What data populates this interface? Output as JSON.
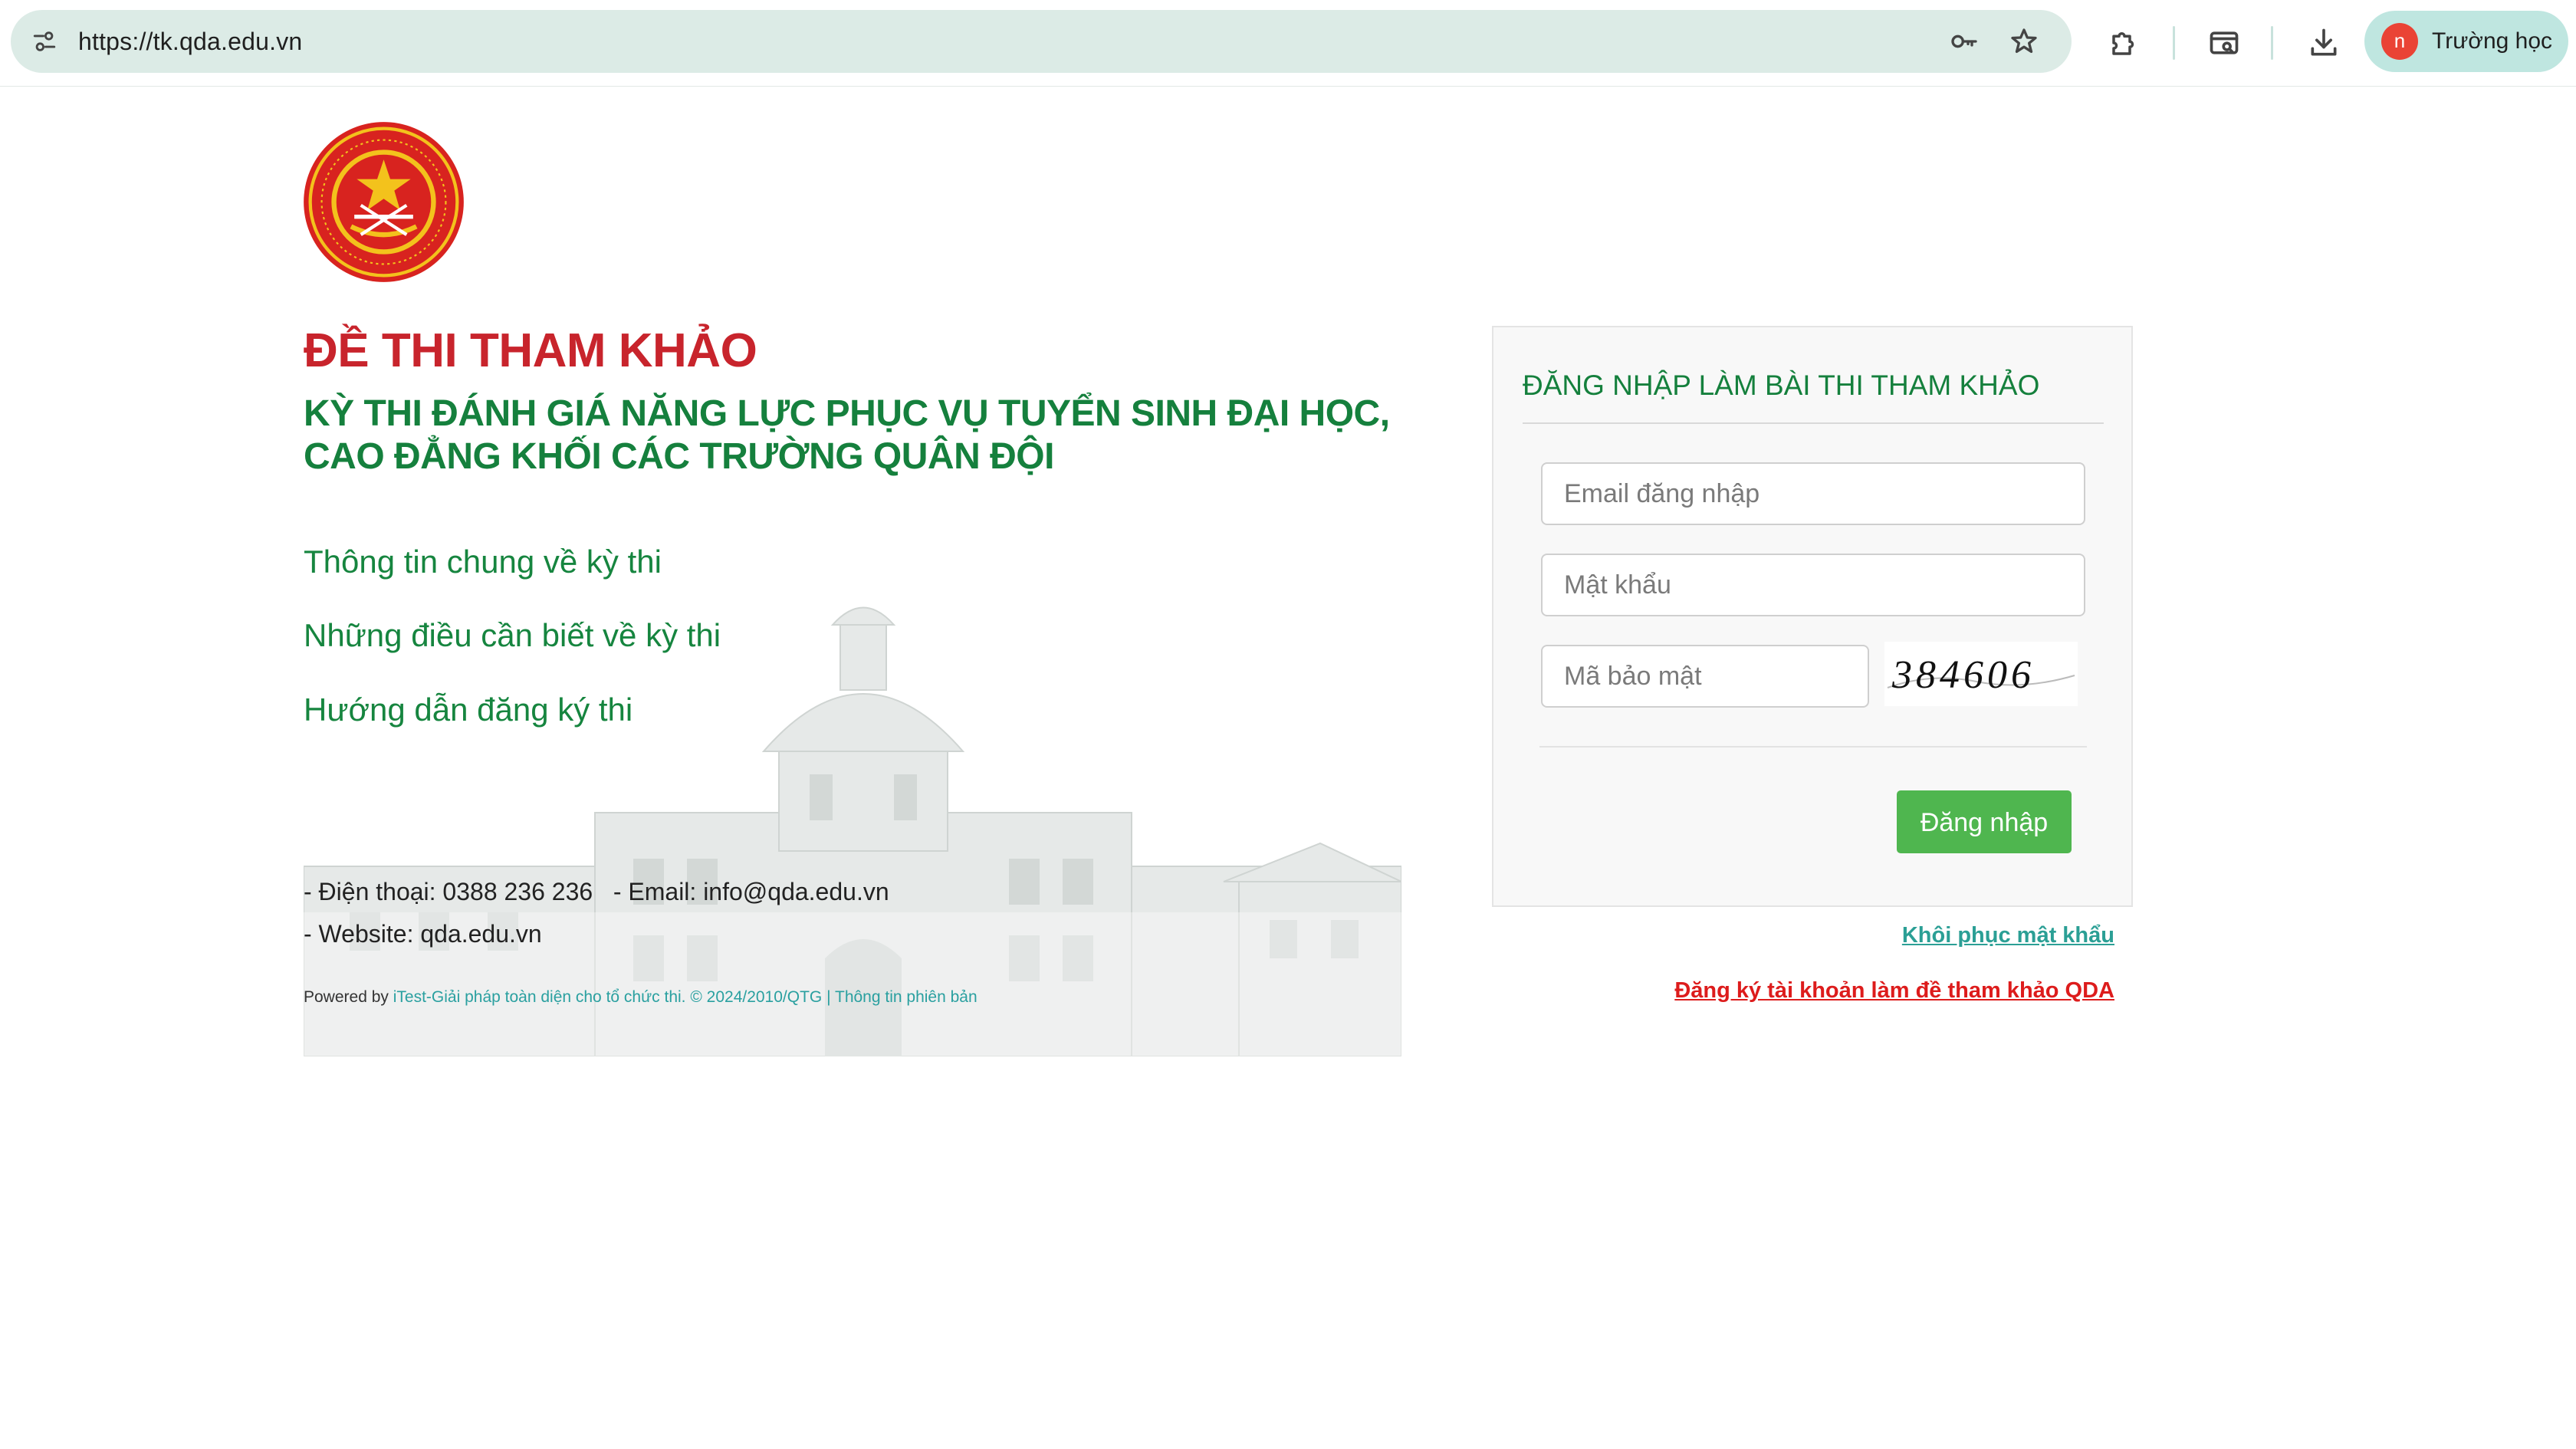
{
  "browser": {
    "url": "https://tk.qda.edu.vn",
    "profile_initial": "n",
    "profile_name": "Trường học"
  },
  "header": {
    "title": "ĐỀ THI THAM KHẢO",
    "subtitle_line1": "KỲ THI ĐÁNH GIÁ NĂNG LỰC PHỤC VỤ TUYỂN SINH ĐẠI HỌC,",
    "subtitle_line2": "CAO ĐẲNG KHỐI CÁC TRƯỜNG QUÂN ĐỘI"
  },
  "info_links": [
    "Thông tin chung về kỳ thi",
    "Những điều cần biết về kỳ thi",
    "Hướng dẫn đăng ký thi"
  ],
  "contact": {
    "phone_line": "- Điện thoại: 0388 236 236   - Email: info@qda.edu.vn",
    "website_line": "- Website: qda.edu.vn"
  },
  "footer": {
    "powered_label": "Powered by ",
    "powered_link": "iTest-Giải pháp toàn diện cho tổ chức thi. © 2024/2010/QTG | Thông tin phiên bản"
  },
  "login": {
    "title": "ĐĂNG NHẬP LÀM BÀI THI THAM KHẢO",
    "email_placeholder": "Email đăng nhập",
    "password_placeholder": "Mật khẩu",
    "captcha_placeholder": "Mã bảo mật",
    "captcha_code": "384606",
    "submit_label": "Đăng nhập",
    "recover_label": "Khôi phục mật khẩu",
    "register_label": "Đăng ký tài khoản làm đề tham khảo QDA"
  },
  "colors": {
    "brand_red": "#c8242c",
    "brand_green": "#15803d",
    "button_green": "#4fb64f"
  },
  "icons": {
    "site_info": "tune-icon",
    "password_manager": "key-icon",
    "bookmark": "star-icon",
    "extensions": "puzzle-icon",
    "tab_search": "tab-search-icon",
    "downloads": "download-icon"
  }
}
